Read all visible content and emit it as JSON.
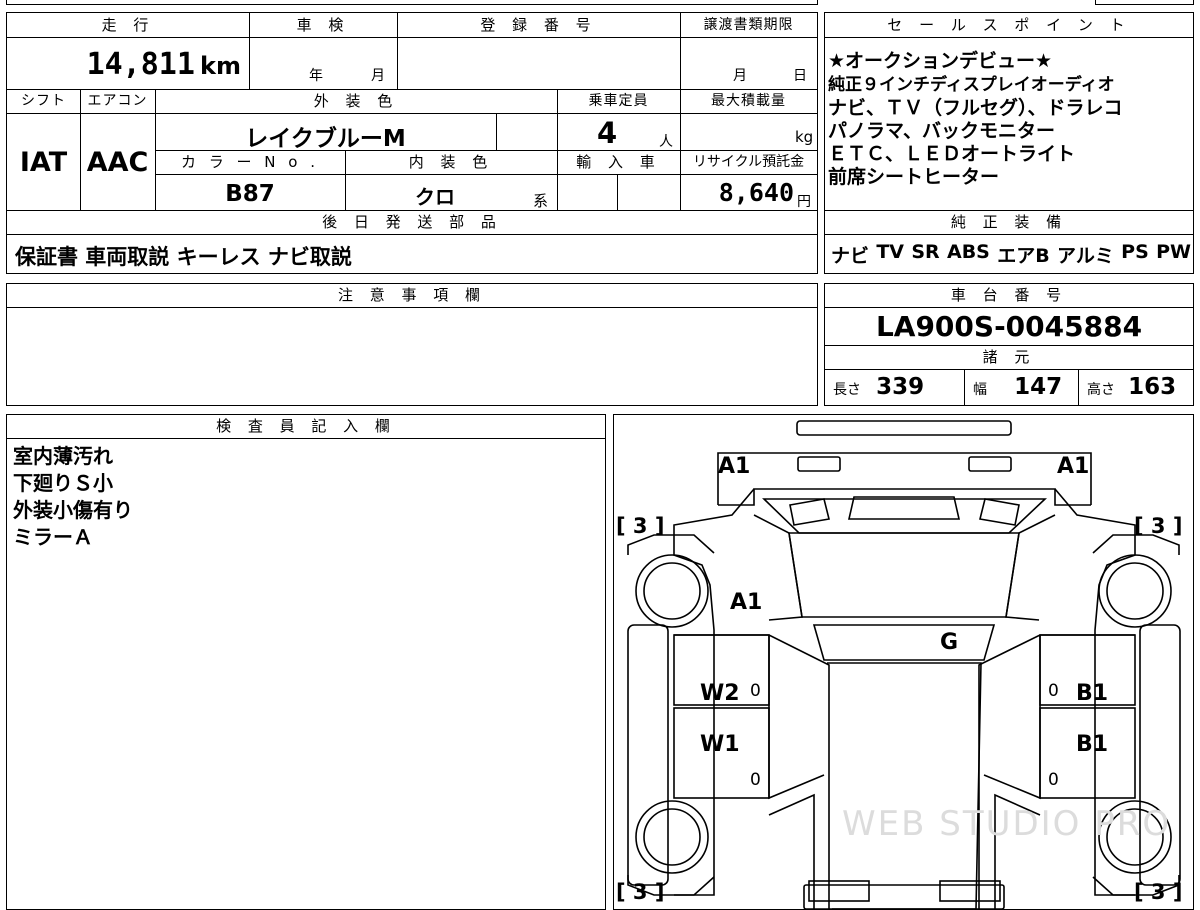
{
  "top_table": {
    "h_mileage": "走 行",
    "h_shaken": "車 検",
    "h_reg": "登 録 番 号",
    "h_transfer": "譲渡書類期限",
    "mileage_value": "14,811",
    "mileage_unit": "km",
    "shaken_year": "年",
    "shaken_month": "月",
    "transfer_month": "月",
    "transfer_day": "日",
    "h_shift": "シフト",
    "h_ac": "エアコン",
    "h_exterior": "外 装 色",
    "h_capacity": "乗車定員",
    "h_maxload": "最大積載量",
    "shift_value": "IAT",
    "ac_value": "AAC",
    "exterior_value": "レイクブルーM",
    "capacity_value": "4",
    "capacity_unit": "人",
    "maxload_unit": "kg",
    "h_colorno": "カ ラ ー N o .",
    "h_interior": "内 装 色",
    "h_import": "輸 入 車",
    "h_recycle": "リサイクル預託金",
    "colorno_value": "B87",
    "interior_value": "クロ",
    "interior_suffix": "系",
    "recycle_value": "8,640",
    "recycle_unit": "円",
    "h_later": "後 日 発 送 部 品",
    "later_value": "保証書 車両取説 キーレス ナビ取説"
  },
  "sales_point": {
    "header": "セ ー ル ス ポ イ ン ト",
    "lines": [
      "★オークションデビュー★",
      "純正９インチディスプレイオーディオ",
      "ナビ、ＴＶ（フルセグ）、ドラレコ",
      "パノラマ、バックモニター",
      "ＥＴＣ、ＬＥＤオートライト",
      "前席シートヒーター"
    ]
  },
  "equipment": {
    "header": "純 正 装 備",
    "items": [
      "ナビ",
      "TV",
      "SR",
      "ABS",
      "エアB",
      "アルミ",
      "PS",
      "PW"
    ]
  },
  "notes": {
    "header": "注 意 事 項 欄"
  },
  "chassis": {
    "header": "車 台 番 号",
    "value": "LA900S-0045884"
  },
  "specs": {
    "header": "諸 元",
    "length_label": "長さ",
    "length_value": "339",
    "width_label": "幅",
    "width_value": "147",
    "height_label": "高さ",
    "height_value": "163"
  },
  "inspector": {
    "header": "検 査 員 記 入 欄",
    "lines": [
      "室内薄汚れ",
      "下廻りＳ小",
      "外装小傷有り",
      "ミラーＡ"
    ]
  },
  "diagram": {
    "label_a1_left": "A1",
    "label_a1_right": "A1",
    "label_a1_center": "A1",
    "label_g": "G",
    "label_w2": "W2",
    "label_w1": "W1",
    "label_b1_upper": "B1",
    "label_b1_lower": "B1",
    "tire_tl": "[ 3 ]",
    "tire_tr": "[ 3 ]",
    "tire_bl": "[ 3 ]",
    "tire_br": "[ 3 ]",
    "zero_1": "0",
    "zero_2": "0",
    "zero_3": "0",
    "zero_4": "0",
    "watermark": "WEB STUDIO PRO"
  }
}
